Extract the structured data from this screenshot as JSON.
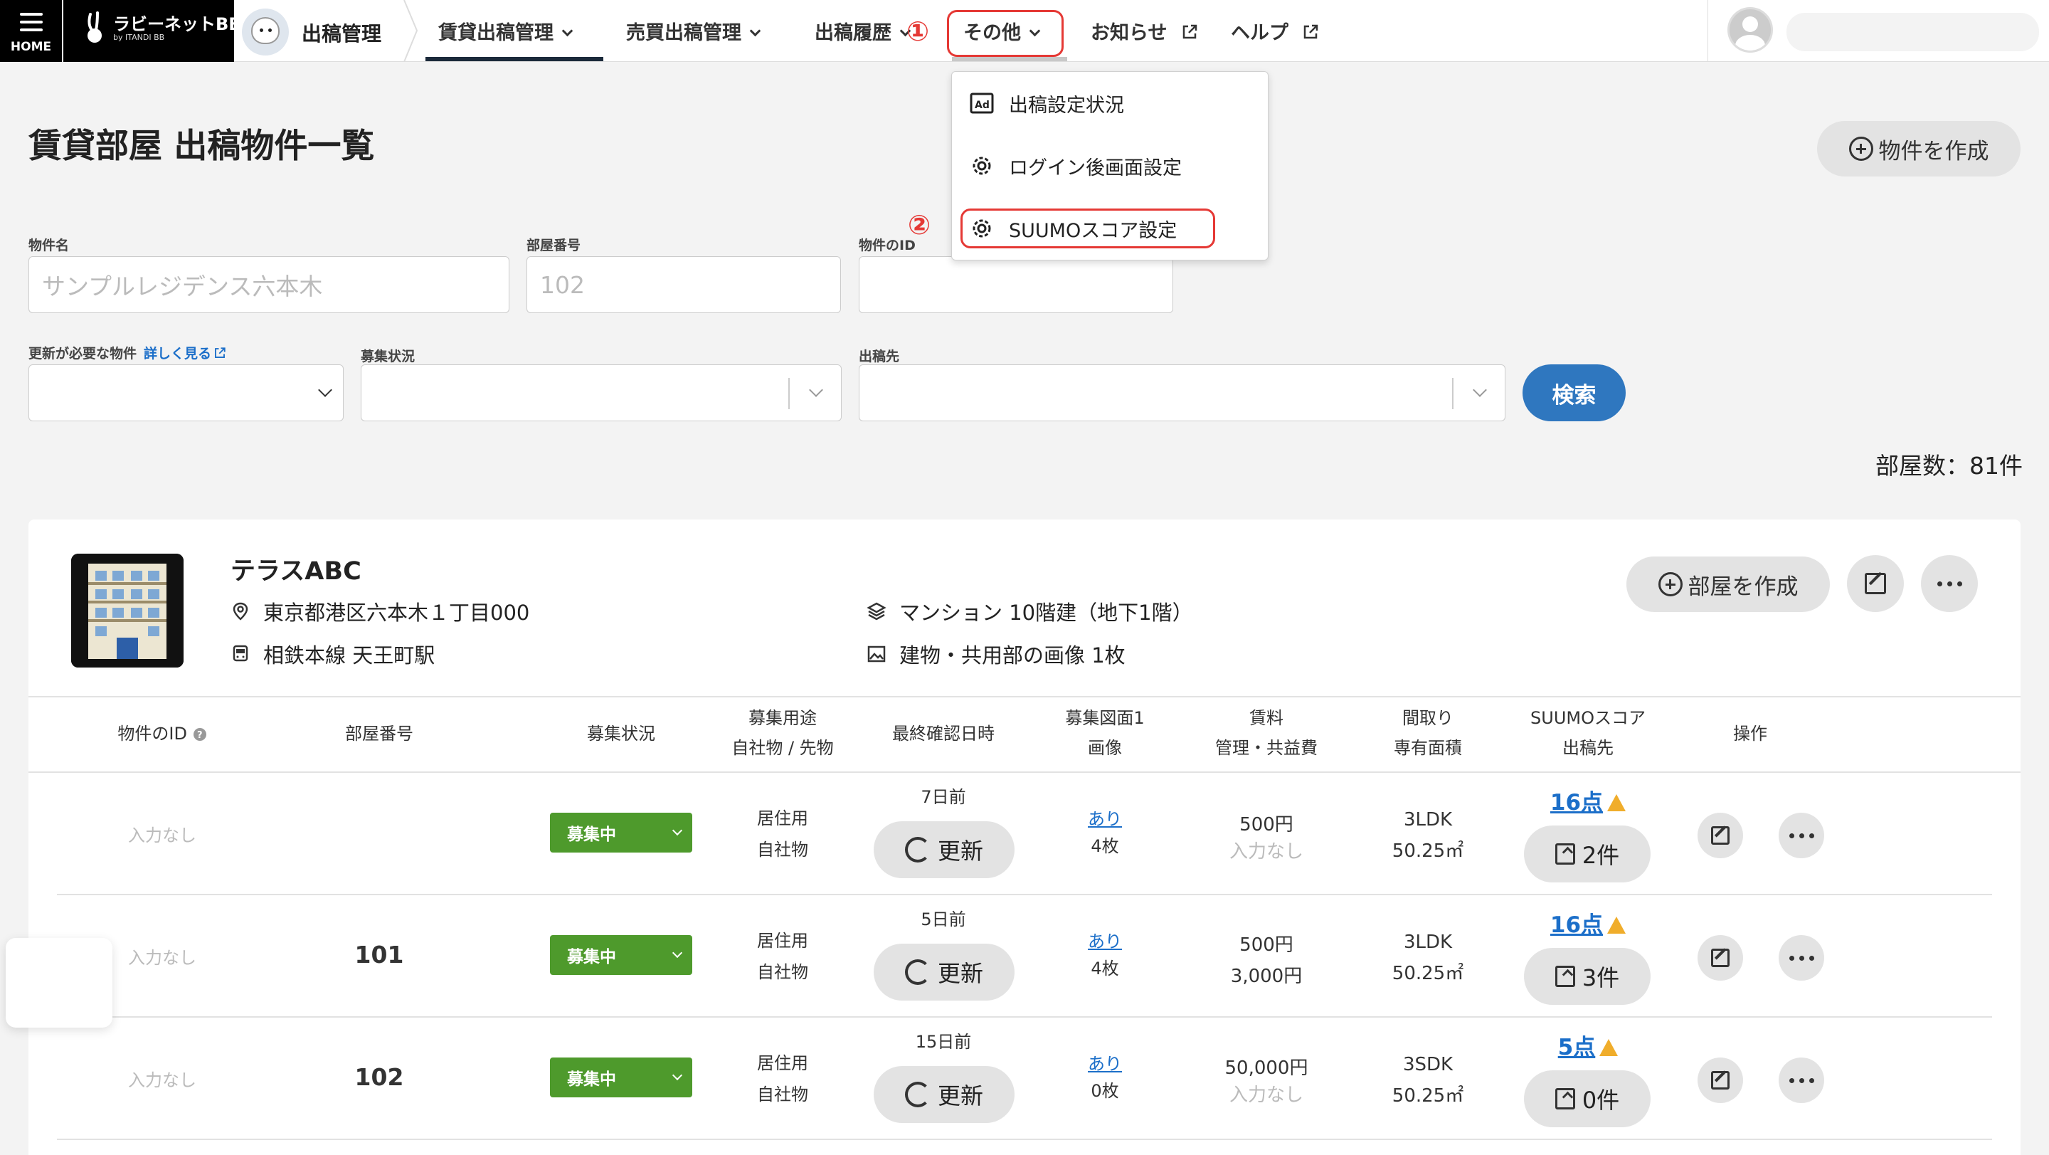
{
  "nav": {
    "home_label": "HOME",
    "brand_name": "ラビーネットBB",
    "brand_sub": "by ITANDI BB",
    "app_title": "出稿管理",
    "items": [
      {
        "label": "賃貸出稿管理",
        "state": "active"
      },
      {
        "label": "売買出稿管理"
      },
      {
        "label": "出稿履歴"
      },
      {
        "label": "その他",
        "state": "open"
      },
      {
        "label": "お知らせ"
      },
      {
        "label": "ヘルプ"
      }
    ],
    "markers": [
      "①",
      "②"
    ]
  },
  "menu": {
    "items": [
      {
        "label": "出稿設定状況",
        "icon": "ad-icon"
      },
      {
        "label": "ログイン後画面設定",
        "icon": "gear-icon"
      },
      {
        "label": "SUUMOスコア設定",
        "icon": "gear-icon"
      }
    ]
  },
  "page": {
    "title": "賃貸部屋 出稿物件一覧",
    "create_property": "物件を作成",
    "room_count": "部屋数：81件"
  },
  "filters": {
    "property_name_label": "物件名",
    "property_name_placeholder": "サンプルレジデンス六本木",
    "room_no_label": "部屋番号",
    "room_no_placeholder": "102",
    "property_id_label": "物件のID",
    "needs_update_label": "更新が必要な物件",
    "needs_update_link": "詳しく見る",
    "status_label": "募集状況",
    "destination_label": "出稿先",
    "search_label": "検索"
  },
  "property": {
    "name": "テラスABC",
    "address": "東京都港区六本木１丁目000",
    "station": "相鉄本線 天王町駅",
    "building": "マンション 10階建（地下1階）",
    "images": "建物・共用部の画像 1枚",
    "create_room": "部屋を作成"
  },
  "table": {
    "headers": {
      "id": "物件のID",
      "room_no": "部屋番号",
      "status": "募集状況",
      "usage": "募集用途",
      "usage2": "自社物 / 先物",
      "last_check": "最終確認日時",
      "plan1": "募集図面1",
      "plan2": "画像",
      "rent1": "賃料",
      "rent2": "管理・共益費",
      "layout1": "間取り",
      "layout2": "専有面積",
      "suumo1": "SUUMOスコア",
      "suumo2": "出稿先",
      "ops": "操作"
    },
    "rows": [
      {
        "id": "入力なし",
        "room_no": "",
        "status": "募集中",
        "usage": "居住用",
        "owner": "自社物",
        "ago": "7日前",
        "update": "更新",
        "plan": "あり",
        "images": "4枚",
        "rent": "500円",
        "fee": "入力なし",
        "layout": "3LDK",
        "area": "50.25㎡",
        "score": "16点",
        "pubs": "2件"
      },
      {
        "id": "入力なし",
        "room_no": "101",
        "status": "募集中",
        "usage": "居住用",
        "owner": "自社物",
        "ago": "5日前",
        "update": "更新",
        "plan": "あり",
        "images": "4枚",
        "rent": "500円",
        "fee": "3,000円",
        "layout": "3LDK",
        "area": "50.25㎡",
        "score": "16点",
        "pubs": "3件"
      },
      {
        "id": "入力なし",
        "room_no": "102",
        "status": "募集中",
        "usage": "居住用",
        "owner": "自社物",
        "ago": "15日前",
        "update": "更新",
        "plan": "あり",
        "images": "0枚",
        "rent": "50,000円",
        "fee": "入力なし",
        "layout": "3SDK",
        "area": "50.25㎡",
        "score": "5点",
        "pubs": "0件"
      }
    ]
  },
  "colors": {
    "accent": "#2f77bf",
    "status_green": "#4e9a2c",
    "highlight_red": "#e53935",
    "warn": "#f0ad2b"
  }
}
